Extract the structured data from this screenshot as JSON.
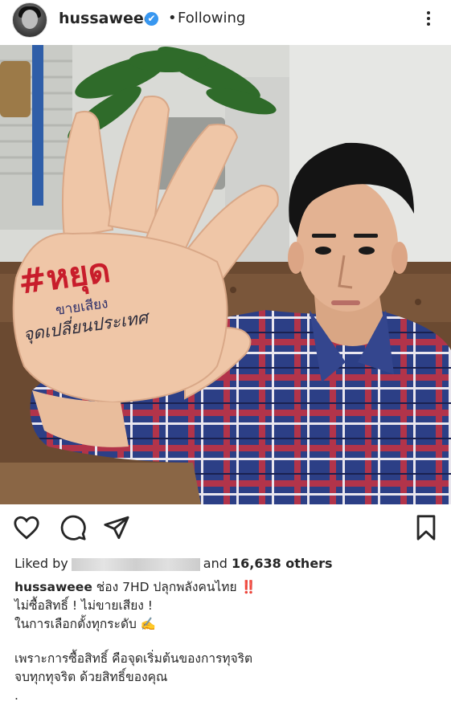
{
  "header": {
    "username": "hussaweee",
    "verified_mark": "✔",
    "separator": "•",
    "follow_status": "Following"
  },
  "photo": {
    "hand_text": {
      "hashtag": "#หยุด",
      "line2": "ขายเสียง",
      "line3": "จุดเปลี่ยนประเทศ"
    }
  },
  "actions": {
    "icons": [
      "heart-icon",
      "comment-icon",
      "share-icon",
      "bookmark-icon"
    ]
  },
  "likes": {
    "prefix": "Liked by",
    "suffix_and": "and",
    "count": "16,638 others"
  },
  "caption": {
    "username": "hussaweee",
    "line1_text": "ช่อง 7HD ปลุกพลังคนไทย",
    "line1_mark": "‼️",
    "line2": "ไม่ซื้อสิทธิ์ ! ไม่ขายเสียง !",
    "line3": "ในการเลือกตั้งทุกระดับ ✍️",
    "line4": "เพราะการซื้อสิทธิ์ คือจุดเริ่มต้นของการทุจริต",
    "line5": "จบทุกทุจริต ด้วยสิทธิ์ของคุณ",
    "line6": "."
  },
  "colors": {
    "verified_blue": "#3897f0",
    "text": "#262626",
    "alert_red": "#e0142d"
  }
}
